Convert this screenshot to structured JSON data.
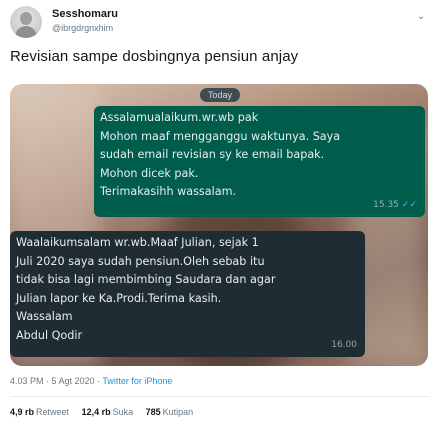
{
  "user": {
    "display_name": "Sesshomaru",
    "handle": "@ibrgdrgnxhim"
  },
  "tweet": {
    "text": "Revisian sampe dosbingnya pensiun anjay",
    "timestamp": "4.03 PM · 5 Agt 2020 · ",
    "source": "Twitter for iPhone"
  },
  "chat": {
    "date_label": "Today",
    "outgoing": {
      "lines": [
        "Assalamualaikum.wr.wb pak",
        "Mohon maaf mengganggu waktunya. Saya",
        "sudah email revisian sy ke email bapak.",
        "Mohon dicek pak.",
        "Terimakasihh wassalam."
      ],
      "time": "15.35",
      "ticks": "✓✓"
    },
    "incoming": {
      "lines": [
        "Waalaikumsalam wr.wb.Maaf Julian, sejak 1",
        "Juli 2020 saya sudah pensiun.Oleh sebab itu",
        "tidak bisa lagi membimbing Saudara dan agar",
        "Julian lapor ke Ka.Prodi.Terima kasih.",
        "Wassalam",
        "Abdul Qodir"
      ],
      "time": "16.00"
    }
  },
  "stats": {
    "retweets_count": "4,9 rb",
    "retweets_label": "Retweet",
    "likes_count": "12,4 rb",
    "likes_label": "Suka",
    "quotes_count": "785",
    "quotes_label": "Kutipan"
  }
}
